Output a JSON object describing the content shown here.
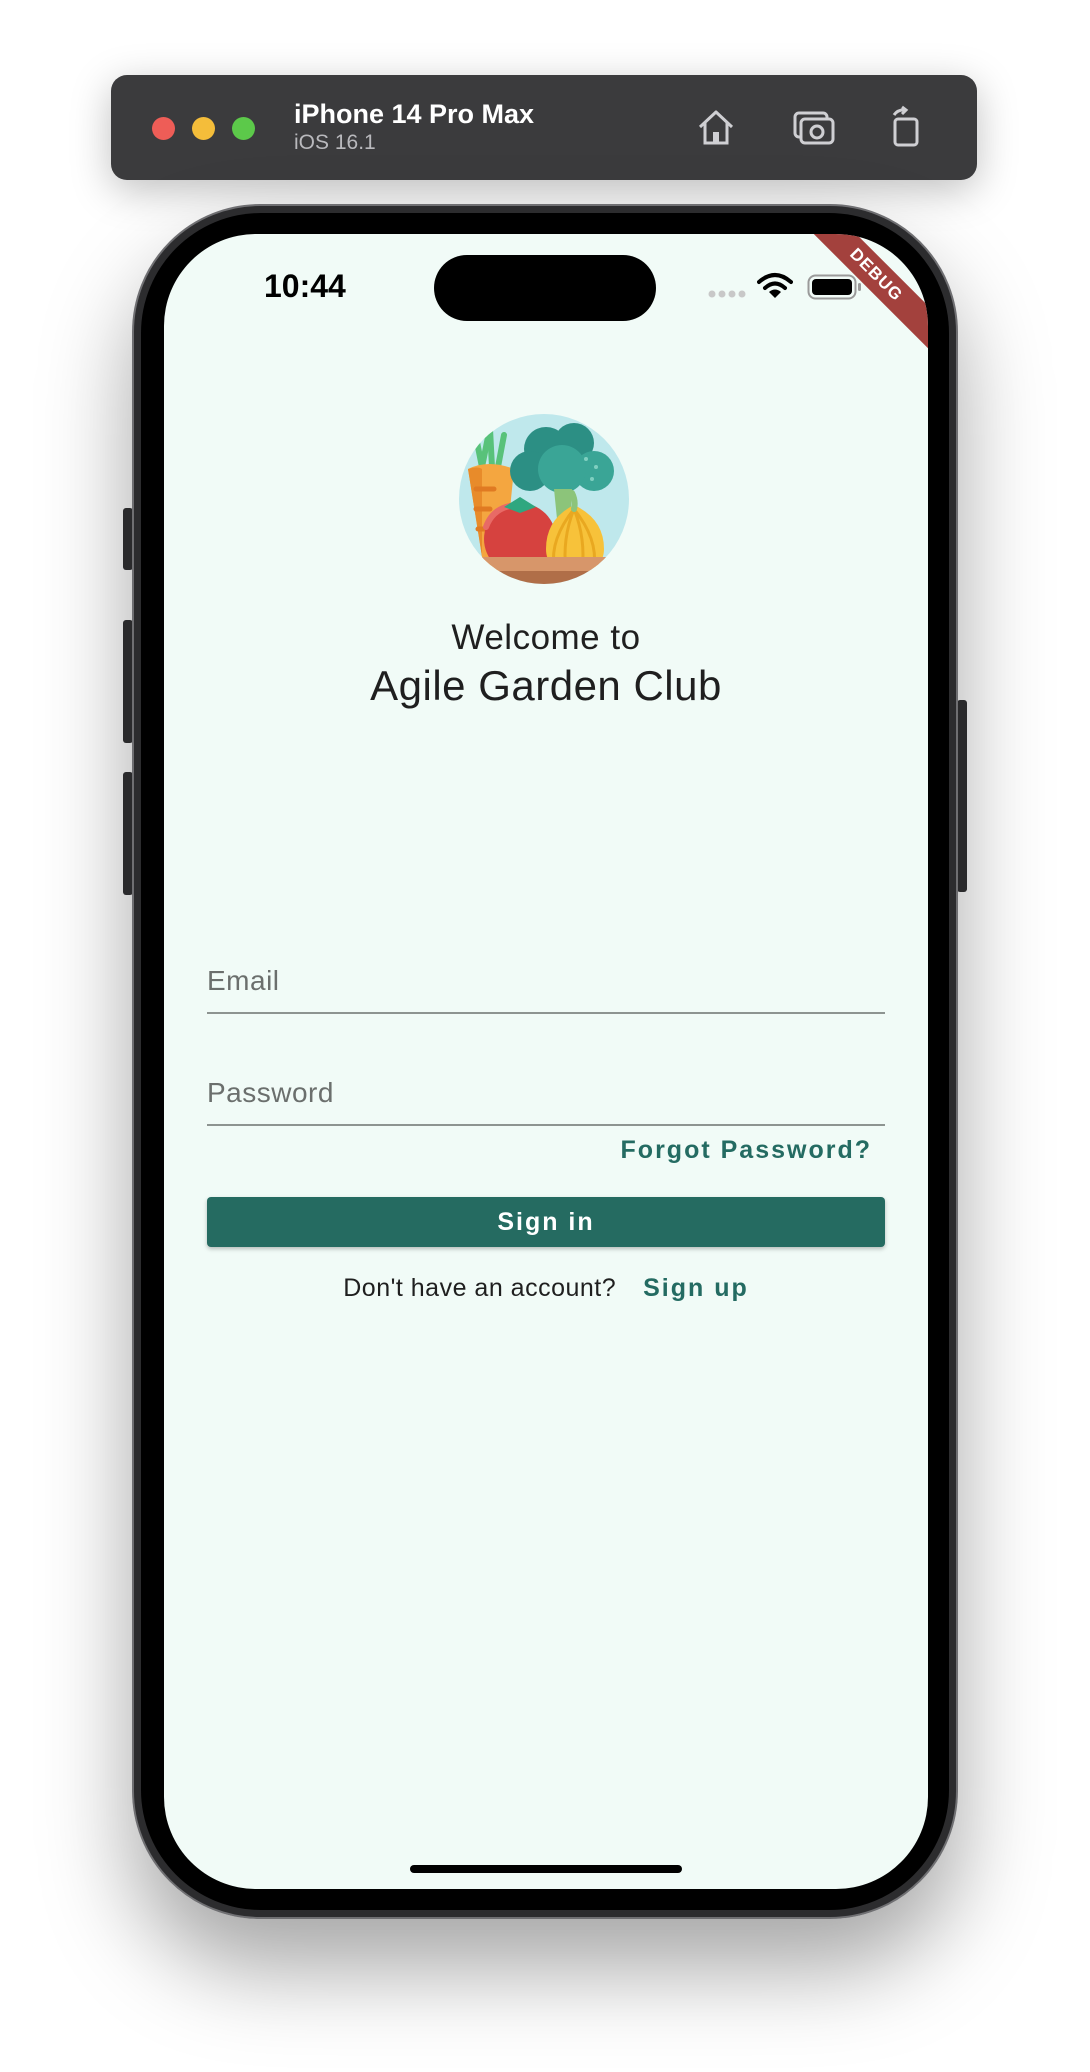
{
  "simulator": {
    "device_name": "iPhone 14 Pro Max",
    "os_version": "iOS 16.1",
    "icons": [
      "home-icon",
      "screenshot-icon",
      "rotate-icon"
    ]
  },
  "status_bar": {
    "time": "10:44",
    "debug_label": "DEBUG"
  },
  "header": {
    "welcome": "Welcome to",
    "title": "Agile Garden Club"
  },
  "form": {
    "email_placeholder": "Email",
    "password_placeholder": "Password",
    "forgot_password": "Forgot Password?",
    "sign_in": "Sign in",
    "no_account": "Don't have an account?",
    "sign_up": "Sign up"
  },
  "colors": {
    "background": "#f1fbf7",
    "accent": "#256b61",
    "debug_banner": "#a3413d"
  }
}
